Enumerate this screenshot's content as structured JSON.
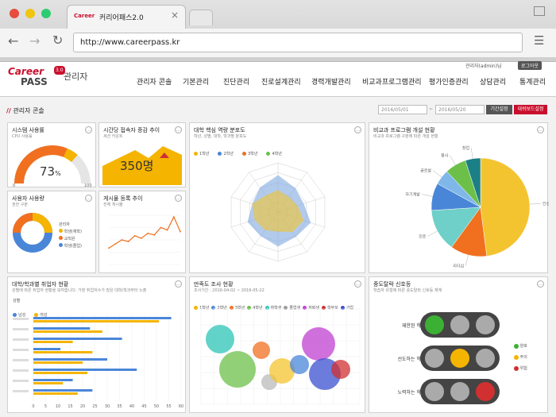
{
  "browser": {
    "tab_title": "커리어패스2.0",
    "url": "http://www.careerpass.kr",
    "close": "×"
  },
  "brand": {
    "logo1": "Career",
    "logo2": "PASS",
    "logo_ver": "3.0",
    "admin": "관리자"
  },
  "user": {
    "name": "관리자(admin)님",
    "logout": "로그아웃"
  },
  "nav": [
    "관리자 콘솔",
    "기본관리",
    "진단관리",
    "진로설계관리",
    "경력개발관리",
    "비교과프로그램관리",
    "평가인증관리",
    "상담관리",
    "통계관리"
  ],
  "console": {
    "title": "관리자 콘솔",
    "date_from": "2016/05/01",
    "date_to": "2016/05/20",
    "sep": "~",
    "period_btn": "기간설정",
    "dash_btn": "대쉬보드설정"
  },
  "cards": {
    "sys": {
      "title": "시스템 사용률",
      "sub": "CPU 사용률",
      "value": "73",
      "unit": "%",
      "min": "0",
      "max": "100",
      "percent": 73
    },
    "conn": {
      "title": "시간당 접속자 증감 추이",
      "sub": "세션 카운트",
      "value": "350명"
    },
    "users": {
      "title": "사용자 사용량",
      "sub": "권한 구분",
      "legend": [
        "관리자",
        "학생(재학)",
        "교직원",
        "학생(졸업)"
      ]
    },
    "posts": {
      "title": "게시물 등록 추이",
      "sub": "전체 게시물"
    },
    "radar": {
      "title": "대학 핵심 역량 분포도",
      "sub": "학년, 성별, 대학, 학과별 분포도",
      "legend": [
        "1학년",
        "2학년",
        "3학년",
        "4학년"
      ]
    },
    "pie": {
      "title": "비교과 프로그램 개설 현황",
      "sub": "비교과 프로그램 구분에 따른 개설 현황",
      "labels": [
        "인성",
        "리더십",
        "진로",
        "자기계발",
        "글로벌",
        "봉사",
        "창업"
      ]
    },
    "jobs": {
      "title": "대학/학과별 취업자 현황",
      "sub": "성별에 따른 취업자 현황을 보여줍니다. 가장 취업자수가 많은 대학/학과부터 노출",
      "legend_title": "성별",
      "legend": [
        "남성",
        "여성"
      ]
    },
    "survey": {
      "title": "만족도 조사 현황",
      "sub": "조사기간 : 2016-04-02 ~ 2016-05-22",
      "legend": [
        "1학년",
        "2학년",
        "3학년",
        "4학년",
        "취학생",
        "졸업생",
        "자퇴생",
        "학부모",
        "기업"
      ]
    },
    "drop": {
      "title": "중도탈락 신호등",
      "sub": "학습자 유형에 따른 중도탈락 신호등 체계",
      "rows": [
        "재한된 학습자",
        "선도하는 학습자",
        "노력하는 학습자"
      ],
      "legend": [
        "양호",
        "주의",
        "위험"
      ]
    }
  },
  "chart_data": [
    {
      "type": "bar",
      "title": "대학/학과별 취업자 현황",
      "series": [
        {
          "name": "남성",
          "values": [
            56,
            23,
            36,
            11,
            30,
            42,
            16,
            24
          ]
        },
        {
          "name": "여성",
          "values": [
            51,
            28,
            16,
            24,
            20,
            22,
            12,
            18
          ]
        }
      ],
      "xlim": [
        0,
        60
      ]
    },
    {
      "type": "pie",
      "title": "비교과 프로그램 개설 현황",
      "categories": [
        "인성",
        "리더십",
        "진로",
        "자기계발",
        "글로벌",
        "봉사",
        "창업"
      ],
      "values": [
        48,
        12,
        14,
        9,
        5,
        7,
        5
      ]
    },
    {
      "type": "line",
      "title": "게시물 등록 추이",
      "values": [
        20,
        25,
        30,
        28,
        35,
        32,
        38,
        36,
        45,
        42,
        58,
        40
      ]
    }
  ],
  "colors": {
    "accent": "#c8102e",
    "blue": "#4a86d8",
    "yellow": "#f4b400",
    "orange": "#f07020",
    "green": "#6cc04a",
    "teal": "#1b7f86",
    "red": "#d03030"
  }
}
